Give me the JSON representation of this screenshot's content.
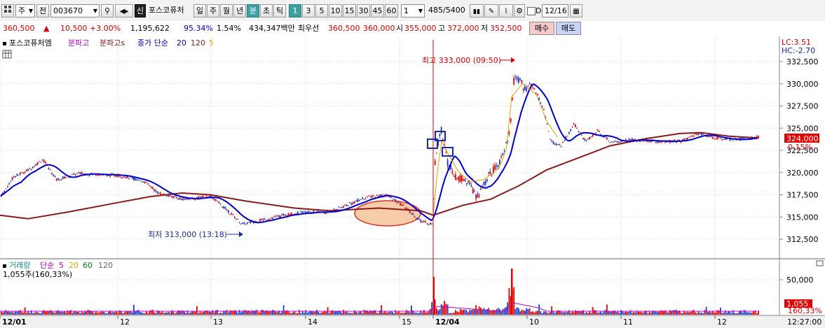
{
  "toolbar": {
    "market_select": "주",
    "prev_label": "전",
    "code": "003670",
    "sin_label": "신",
    "stock_name": "포스코퓨처",
    "periods": [
      "일",
      "주",
      "월",
      "년",
      "분",
      "초",
      "틱"
    ],
    "active_period": "분",
    "intervals": [
      "1",
      "3",
      "5",
      "10",
      "15",
      "30",
      "45",
      "60"
    ],
    "active_interval": "1",
    "interval_value": "1",
    "count": "485",
    "total": "/5400",
    "d_label": "D",
    "date": "12/16"
  },
  "quote": {
    "price": "360,500",
    "arrow": "▲",
    "change": "10,500",
    "change_pct": "+3.00%",
    "volume": "1,195,622",
    "ratio1": "95.34%",
    "ratio2": "1.54%",
    "amount": "434,347백만",
    "best_label": "최우선",
    "ask": "360,500",
    "bid": "360,000",
    "open_label": "시",
    "open": "355,000",
    "high_label": "고",
    "high": "372,000",
    "low_label": "저",
    "low": "352,500",
    "buy_label": "매수",
    "sell_label": "매도"
  },
  "legend": {
    "name": "포스코퓨처엠",
    "i1": "분파고",
    "i2": "분파고s",
    "ma_label": "종가 단순",
    "ma1": "20",
    "ma2": "120",
    "ma3": "5"
  },
  "lc": "LC:3.51",
  "hc": "HC:-2.70",
  "current_price": "324,000",
  "current_pct": "0.15%",
  "annotations": {
    "high_text": "최고 333,000 (09:50)",
    "low_text": "최저 313,000 (13:18)"
  },
  "y_axis": [
    "332,500",
    "330,000",
    "327,500",
    "325,000",
    "322,500",
    "320,000",
    "317,500",
    "315,000",
    "312,500"
  ],
  "volume_legend": {
    "name": "거래량",
    "ma_label": "단순",
    "ma1": "5",
    "ma2": "20",
    "ma3": "60",
    "ma4": "120",
    "unit_text": "1,055주(160,33%)"
  },
  "volume_axis": [
    "50,000"
  ],
  "vol_current": "1,055",
  "vol_pct": "160,33%",
  "x_axis": [
    "12/01",
    "12",
    "13",
    "14",
    "15",
    "12/04",
    "10",
    "11",
    "12"
  ],
  "time": "12:27:00",
  "colors": {
    "up": "#e60000",
    "down": "#1a3cc8",
    "ma20": "#0000cc",
    "ma120": "#8b1a1a",
    "ma5": "#e8a000",
    "accent": "#3aa0a0"
  }
}
